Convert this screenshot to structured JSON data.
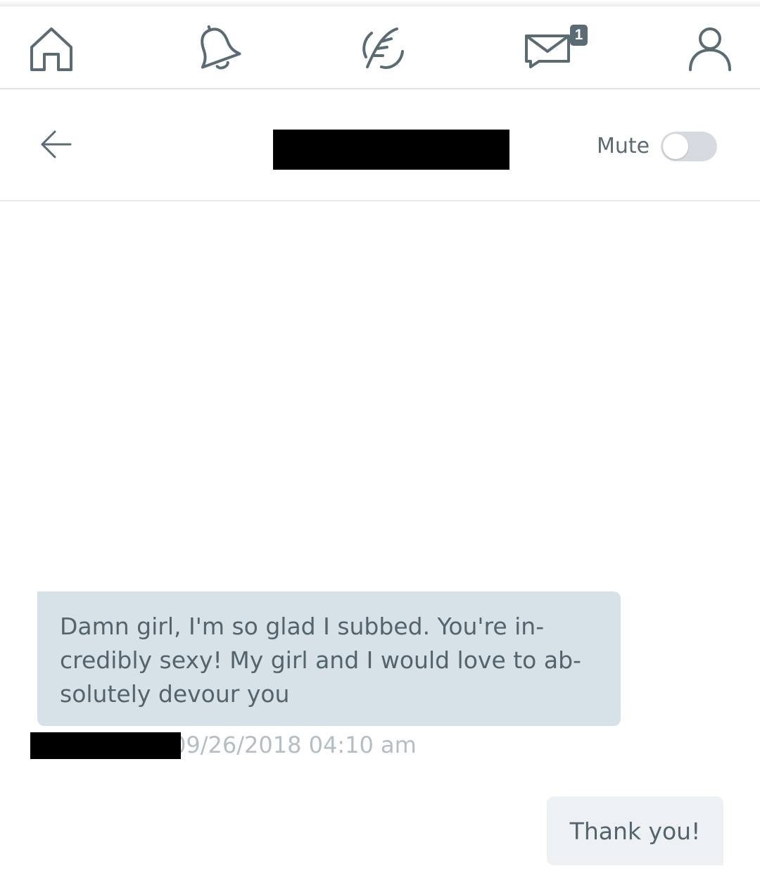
{
  "nav": {
    "icons": [
      "home-icon",
      "bell-icon",
      "feather-icon",
      "envelope-icon",
      "user-icon"
    ],
    "messages_badge": "1"
  },
  "header": {
    "title_redacted": true,
    "mute_label": "Mute",
    "mute_on": false
  },
  "messages": [
    {
      "direction": "incoming",
      "text": "Damn girl, I'm so glad I subbed. You're in­credibly sexy! My girl and I would love to ab­solutely devour you",
      "sender_redacted": true,
      "timestamp": "09/26/2018 04:10 am"
    },
    {
      "direction": "outgoing",
      "text": "Thank you!"
    }
  ],
  "colors": {
    "icon": "#5a6b74",
    "incoming_bubble": "#d6e1e8",
    "outgoing_bubble": "#eef1f3",
    "timestamp": "#b3bec5",
    "toggle_off": "#d5dbe1"
  }
}
